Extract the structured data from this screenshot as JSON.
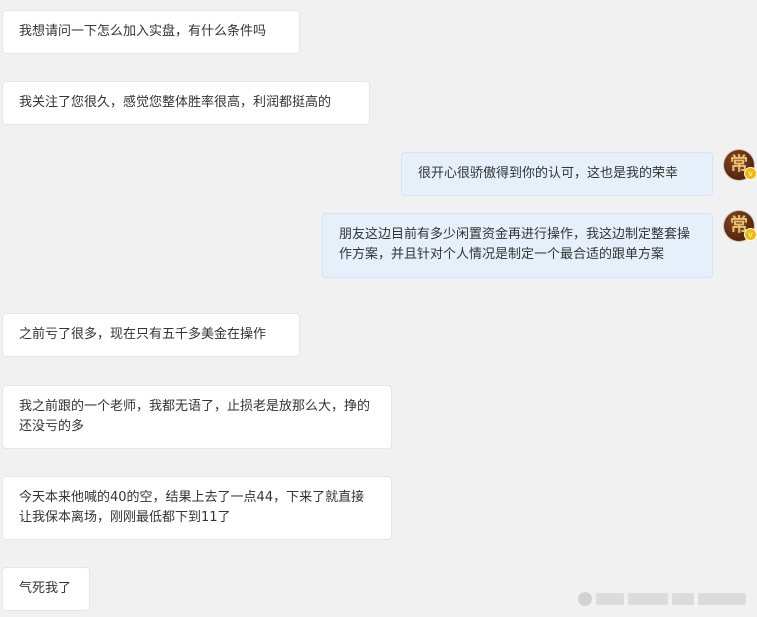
{
  "conversation": {
    "messages": [
      {
        "side": "left",
        "text": "我想请问一下怎么加入实盘，有什么条件吗"
      },
      {
        "side": "left",
        "text": "我关注了您很久，感觉您整体胜率很高，利润都挺高的"
      },
      {
        "side": "right",
        "text": "很开心很骄傲得到你的认可，这也是我的荣幸"
      },
      {
        "side": "right",
        "text": "朋友这边目前有多少闲置资金再进行操作，我这边制定整套操作方案，并且针对个人情况是制定一个最合适的跟单方案"
      },
      {
        "side": "left",
        "text": "之前亏了很多，现在只有五千多美金在操作"
      },
      {
        "side": "left",
        "text": "我之前跟的一个老师，我都无语了，止损老是放那么大，挣的还没亏的多"
      },
      {
        "side": "left",
        "text": "今天本来他喊的40的空，结果上去了一点44，下来了就直接让我保本离场，刚刚最低都下到11了"
      },
      {
        "side": "left",
        "text": "气死我了"
      }
    ]
  },
  "avatar": {
    "glyph": "常",
    "badge": "v",
    "icon": "verified-badge-icon"
  },
  "colors": {
    "background": "#f1f1f1",
    "left_bubble": "#ffffff",
    "right_bubble": "#e6f0fa",
    "avatar_bg": "#5e2c12",
    "badge": "#f5b800"
  }
}
